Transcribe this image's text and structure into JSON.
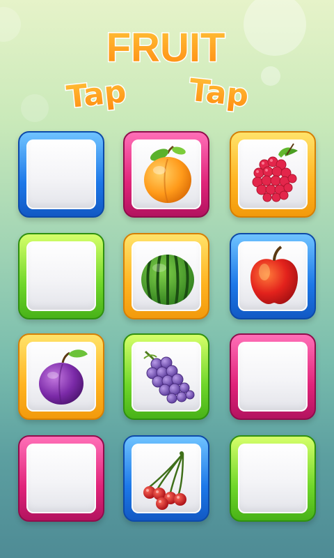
{
  "title": {
    "line1": "FRUIT",
    "word_left": "Tap",
    "word_right": "Tap"
  },
  "colors": {
    "title_fill": "#ff9a1a",
    "title_stroke": "#ffffff",
    "blue": "#1d78e8",
    "pink": "#e0247a",
    "orange": "#ffb320",
    "green": "#6fd62a"
  },
  "board": {
    "tiles": [
      {
        "row": 1,
        "col": 1,
        "frame": "blue",
        "content": ""
      },
      {
        "row": 1,
        "col": 2,
        "frame": "pink",
        "content": "peach-icon"
      },
      {
        "row": 1,
        "col": 3,
        "frame": "orange",
        "content": "raspberry-icon"
      },
      {
        "row": 2,
        "col": 1,
        "frame": "green",
        "content": ""
      },
      {
        "row": 2,
        "col": 2,
        "frame": "orange",
        "content": "watermelon-icon"
      },
      {
        "row": 2,
        "col": 3,
        "frame": "blue",
        "content": "apple-icon"
      },
      {
        "row": 3,
        "col": 1,
        "frame": "orange",
        "content": "plum-icon"
      },
      {
        "row": 3,
        "col": 2,
        "frame": "green",
        "content": "grapes-icon"
      },
      {
        "row": 3,
        "col": 3,
        "frame": "pink",
        "content": ""
      },
      {
        "row": 4,
        "col": 1,
        "frame": "pink",
        "content": ""
      },
      {
        "row": 4,
        "col": 2,
        "frame": "blue",
        "content": "cherries-icon"
      },
      {
        "row": 4,
        "col": 3,
        "frame": "green",
        "content": ""
      }
    ]
  }
}
